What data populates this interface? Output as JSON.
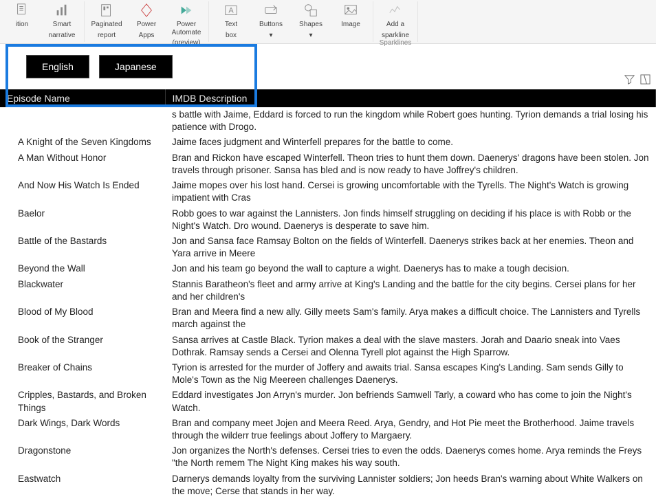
{
  "ribbon": {
    "groups": [
      {
        "label": "",
        "buttons": [
          {
            "name": "lition",
            "label": "ition",
            "icon": "doc"
          },
          {
            "name": "smart-narrative",
            "label": "Smart\nnarrative",
            "icon": "bar"
          }
        ]
      },
      {
        "label": "",
        "buttons": [
          {
            "name": "paginated-report",
            "label": "Paginated\nreport",
            "icon": "page"
          },
          {
            "name": "power-apps",
            "label": "Power\nApps",
            "icon": "diamond"
          },
          {
            "name": "power-automate",
            "label": "Power Automate\n(preview)",
            "icon": "flow"
          }
        ]
      },
      {
        "label": "",
        "buttons": [
          {
            "name": "text-box",
            "label": "Text\nbox",
            "icon": "textbox"
          },
          {
            "name": "buttons",
            "label": "Buttons\n▾",
            "icon": "button"
          },
          {
            "name": "shapes",
            "label": "Shapes\n▾",
            "icon": "shapes"
          },
          {
            "name": "image",
            "label": "Image",
            "icon": "image"
          }
        ]
      },
      {
        "label": "Sparklines",
        "buttons": [
          {
            "name": "add-sparkline",
            "label": "Add a\nsparkline",
            "icon": "spark"
          }
        ]
      }
    ]
  },
  "language_buttons": [
    "English",
    "Japanese"
  ],
  "table": {
    "headers": [
      "Episode Name",
      "IMDB Description"
    ],
    "rows": [
      [
        "",
        "s battle with Jaime, Eddard is forced to run the kingdom while Robert goes hunting. Tyrion demands a trial losing his patience with Drogo."
      ],
      [
        "A Knight of the Seven Kingdoms",
        "Jaime faces judgment and Winterfell prepares for the battle to come."
      ],
      [
        "A Man Without Honor",
        "Bran and Rickon have escaped Winterfell. Theon tries to hunt them down. Daenerys' dragons have been stolen. Jon travels through prisoner. Sansa has bled and is now ready to have Joffrey's children."
      ],
      [
        "And Now His Watch Is Ended",
        "Jaime mopes over his lost hand. Cersei is growing uncomfortable with the Tyrells. The Night's Watch is growing impatient with Cras"
      ],
      [
        "Baelor",
        "Robb goes to war against the Lannisters. Jon finds himself struggling on deciding if his place is with Robb or the Night's Watch. Dro wound. Daenerys is desperate to save him."
      ],
      [
        "Battle of the Bastards",
        "Jon and Sansa face Ramsay Bolton on the fields of Winterfell. Daenerys strikes back at her enemies. Theon and Yara arrive in Meere"
      ],
      [
        "Beyond the Wall",
        "Jon and his team go beyond the wall to capture a wight. Daenerys has to make a tough decision."
      ],
      [
        "Blackwater",
        "Stannis Baratheon's fleet and army arrive at King's Landing and the battle for the city begins. Cersei plans for her and her children's"
      ],
      [
        "Blood of My Blood",
        "Bran and Meera find a new ally. Gilly meets Sam's family. Arya makes a difficult choice. The Lannisters and Tyrells march against the"
      ],
      [
        "Book of the Stranger",
        "Sansa arrives at Castle Black. Tyrion makes a deal with the slave masters. Jorah and Daario sneak into Vaes Dothrak. Ramsay sends a Cersei and Olenna Tyrell plot against the High Sparrow."
      ],
      [
        "Breaker of Chains",
        "Tyrion is arrested for the murder of Joffery and awaits trial. Sansa escapes King's Landing. Sam sends Gilly to Mole's Town as the Nig Meereen challenges Daenerys."
      ],
      [
        "Cripples, Bastards, and Broken Things",
        "Eddard investigates Jon Arryn's murder. Jon befriends Samwell Tarly, a coward who has come to join the Night's Watch."
      ],
      [
        "Dark Wings, Dark Words",
        "Bran and company meet Jojen and Meera Reed. Arya, Gendry, and Hot Pie meet the Brotherhood. Jaime travels through the wilderr true feelings about Joffery to Margaery."
      ],
      [
        "Dragonstone",
        "Jon organizes the North's defenses. Cersei tries to even the odds. Daenerys comes home. Arya reminds the Freys \"the North remem The Night King makes his way south."
      ],
      [
        "Eastwatch",
        "Darnerys demands loyalty from the surviving Lannister soldiers; Jon heeds Bran's warning about White Walkers on the move; Cerse that stands in her way."
      ]
    ]
  }
}
